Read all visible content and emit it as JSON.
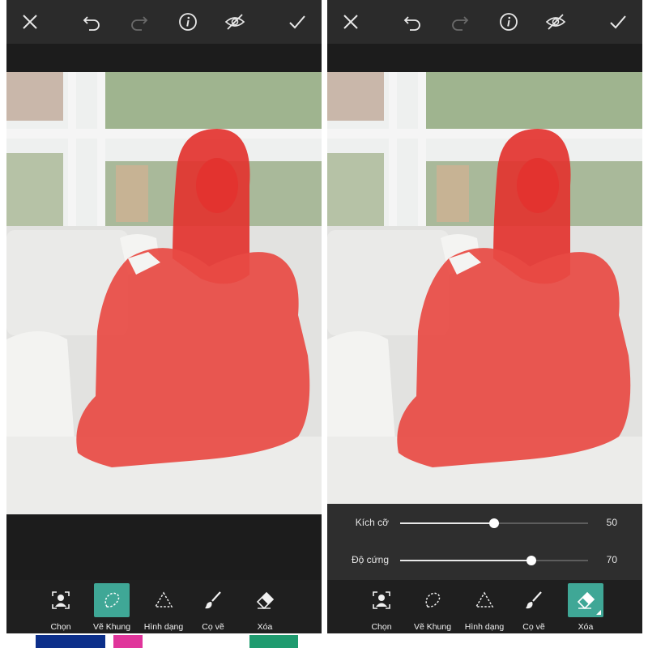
{
  "colors": {
    "accent": "#3fa796",
    "mask": "#e3332f",
    "topbar": "#2b2b2b",
    "toolbar": "#1f1f1f",
    "slider_panel": "#2e2e2e"
  },
  "topbar": {
    "icons": [
      "close-icon",
      "undo-icon",
      "redo-icon",
      "info-icon",
      "visibility-off-icon",
      "checkmark-icon"
    ]
  },
  "left_panel": {
    "active_tool": "ve_khung"
  },
  "right_panel": {
    "active_tool": "xoa",
    "sliders": [
      {
        "label": "Kích cỡ",
        "value": "50",
        "fraction": 0.5
      },
      {
        "label": "Độ cứng",
        "value": "70",
        "fraction": 0.7
      }
    ]
  },
  "tools": {
    "chon": {
      "label": "Chọn",
      "icon": "person-select-icon"
    },
    "ve_khung": {
      "label": "Vẽ Khung",
      "icon": "lasso-icon"
    },
    "hinh_dang": {
      "label": "Hình dạng",
      "icon": "triangle-shape-icon"
    },
    "co_ve": {
      "label": "Cọ vẽ",
      "icon": "brush-icon"
    },
    "xoa": {
      "label": "Xóa",
      "icon": "eraser-icon"
    }
  }
}
